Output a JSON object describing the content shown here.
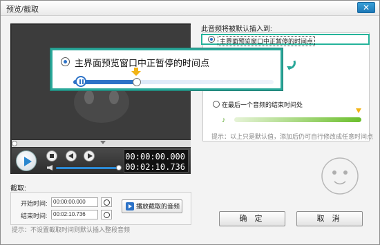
{
  "window": {
    "title": "预览/截取",
    "close_label": "✕"
  },
  "player": {
    "time_current": "00:00:00.000",
    "time_total": "00:02:10.736",
    "volume": 0.95,
    "progress": 0.0
  },
  "insert_panel": {
    "label": "此音频将被默认插入到:",
    "options": [
      {
        "label": "主界面预览窗口中正暂停的时间点",
        "selected": true
      },
      {
        "label": "在最后一个音频的结束时间处",
        "selected": false
      }
    ],
    "hint": "提示：以上只是默认值，添加后仍可自行修改成任意时间点"
  },
  "callout": {
    "label": "主界面预览窗口中正暂停的时间点",
    "progress": 0.3
  },
  "trim": {
    "label": "截取:",
    "start_label": "开始时间:",
    "start_value": "00:00:00.000",
    "end_label": "结束时间:",
    "end_value": "00:02:10.736",
    "play_button": "播放截取的音频",
    "hint": "提示：不设置截取时间则默认插入整段音频"
  },
  "buttons": {
    "ok": "确 定",
    "cancel": "取 消"
  },
  "colors": {
    "accent": "#2c72c7",
    "callout_border": "#2aa89a",
    "green_bar": "#6cbf2d",
    "marker": "#f2b416"
  }
}
